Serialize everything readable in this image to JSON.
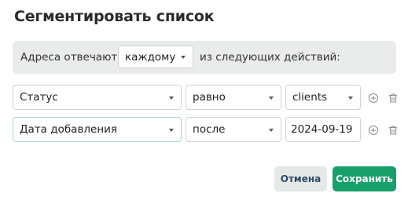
{
  "dialog": {
    "title": "Сегментировать список"
  },
  "match": {
    "prefix": "Адреса отвечают",
    "selected": "каждому",
    "suffix": "из следующих действий:"
  },
  "conditions": [
    {
      "field": "Статус",
      "operator": "равно",
      "value": "clients"
    },
    {
      "field": "Дата добавления",
      "operator": "после",
      "value": "2024-09-19"
    }
  ],
  "buttons": {
    "cancel": "Отмена",
    "save": "Сохранить"
  },
  "colors": {
    "accent": "#18a06a",
    "panel": "#e9eceb",
    "cancel_text": "#2d4a6a"
  }
}
